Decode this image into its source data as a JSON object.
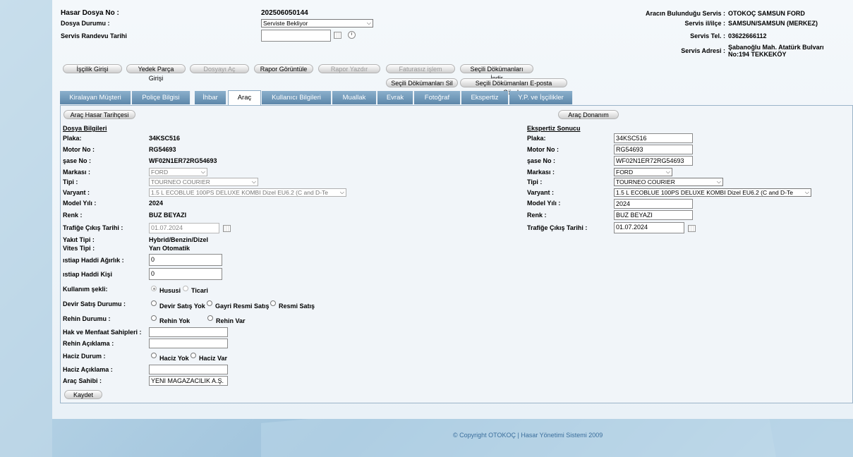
{
  "header": {
    "hasar_dosya_no_label": "Hasar Dosya No :",
    "hasar_dosya_no": "202506050144",
    "dosya_durumu_label": "Dosya Durumu :",
    "dosya_durumu": "Serviste Bekliyor",
    "servis_randevu_label": "Servis Randevu Tarihi",
    "servis_randevu_value": ""
  },
  "service": {
    "servis_label": "Aracın Bulunduğu Servis :",
    "servis": "OTOKOÇ SAMSUN FORD",
    "il_label": "Servis il/ilçe :",
    "il": "SAMSUN/SAMSUN (MERKEZ)",
    "tel_label": "Servis Tel. :",
    "tel": "03622666112",
    "adres_label": "Servis Adresi :",
    "adres_1": "Şabanoğlu Mah. Atatürk Bulvarı",
    "adres_2": "No:194 TEKKEKÖY"
  },
  "actions": {
    "iscilik": "İşçilik Girişi",
    "yedek_parca": "Yedek Parça Girişi",
    "dosyayi_ac": "Dosyayı Aç",
    "rapor_goruntule": "Rapor Görüntüle",
    "rapor_yazdir": "Rapor Yazdır",
    "faturasiz": "Faturasız işlem",
    "dokuman_indir": "Seçili Dökümanları İndir",
    "dokuman_sil": "Seçili Dökümanları Sil",
    "dokuman_eposta": "Seçili Dökümanları E-posta Gönder"
  },
  "tabs": [
    {
      "label": "Kiralayan Müşteri"
    },
    {
      "label": "Poliçe Bilgisi"
    },
    {
      "label": "İhbar"
    },
    {
      "label": "Araç"
    },
    {
      "label": "Kullanıcı Bilgileri"
    },
    {
      "label": "Muallak"
    },
    {
      "label": "Evrak"
    },
    {
      "label": "Fotoğraf"
    },
    {
      "label": "Ekspertiz"
    },
    {
      "label": "Y.P. ve İşçilikler"
    }
  ],
  "arac": {
    "hasar_tarihcesi": "Araç Hasar Tarihçesi",
    "donanim": "Araç Donanım",
    "dosya_bilgileri": "Dosya Bilgileri",
    "ekspertiz_sonucu": "Ekspertiz Sonucu",
    "labels": {
      "plaka": "Plaka:",
      "motor": "Motor No :",
      "sase": "şase No :",
      "marka": "Markası :",
      "tipi": "Tipi :",
      "varyant": "Varyant :",
      "model": "Model Yılı :",
      "renk": "Renk :",
      "trafik": "Trafiğe Çıkış Tarihi :",
      "yakit": "Yakıt Tipi :",
      "vites": "Vites Tipi :",
      "istiap_agirlik": "ıstiap Haddi Ağırlık :",
      "istiap_kisi": "ıstiap Haddi Kişi",
      "kullanim": "Kullanım şekli:",
      "devir": "Devir Satış Durumu :",
      "rehin": "Rehin Durumu :",
      "hak": "Hak ve Menfaat Sahipleri :",
      "rehin_aciklama": "Rehin Açıklama :",
      "haciz": "Haciz Durum :",
      "haciz_aciklama": "Haciz Açıklama :",
      "sahibi": "Araç Sahibi :"
    },
    "left": {
      "plaka": "34KSC516",
      "motor": "RG54693",
      "sase": "WF02N1ER72RG54693",
      "marka": "FORD",
      "tipi": "TOURNEO COURIER",
      "varyant": "1.5 L ECOBLUE 100PS DELUXE KOMBI Dizel EU6.2 (C and D-Te",
      "model": "2024",
      "renk": "BUZ BEYAZI",
      "trafik": "01.07.2024",
      "yakit": "Hybrid/Benzin/Dizel",
      "vites": "Yarı Otomatik",
      "istiap_agirlik": "0",
      "istiap_kisi": "0",
      "sahibi": "YENI MAGAZACILIK A.Ş."
    },
    "right_labels": {
      "plaka": "Plaka:",
      "motor": "Motor No :",
      "sase": "şase No :",
      "marka": "Markası :",
      "tipi": "Tipi :",
      "varyant": "Varyant :",
      "model": "Model Yılı :",
      "renk": "Renk :",
      "trafik": "Trafiğe Çıkış Tarihi :"
    },
    "right": {
      "plaka": "34KSC516",
      "motor": "RG54693",
      "sase": "WF02N1ER72RG54693",
      "marka": "FORD",
      "tipi": "TOURNEO COURIER",
      "varyant": "1.5 L ECOBLUE 100PS DELUXE KOMBI Dizel EU6.2 (C and D-Te",
      "model": "2024",
      "renk": "BUZ BEYAZI",
      "trafik": "01.07.2024"
    },
    "radios": {
      "hususi": "Hususi",
      "ticari": "Ticari",
      "devir_yok": "Devir Satış Yok",
      "gayri_resmi": "Gayri Resmi Satış",
      "resmi": "Resmi Satış",
      "rehin_yok": "Rehin Yok",
      "rehin_var": "Rehin Var",
      "haciz_yok": "Haciz Yok",
      "haciz_var": "Haciz Var"
    },
    "kaydet": "Kaydet"
  },
  "footer": "© Copyright OTOKOÇ | Hasar Yönetimi Sistemi 2009"
}
